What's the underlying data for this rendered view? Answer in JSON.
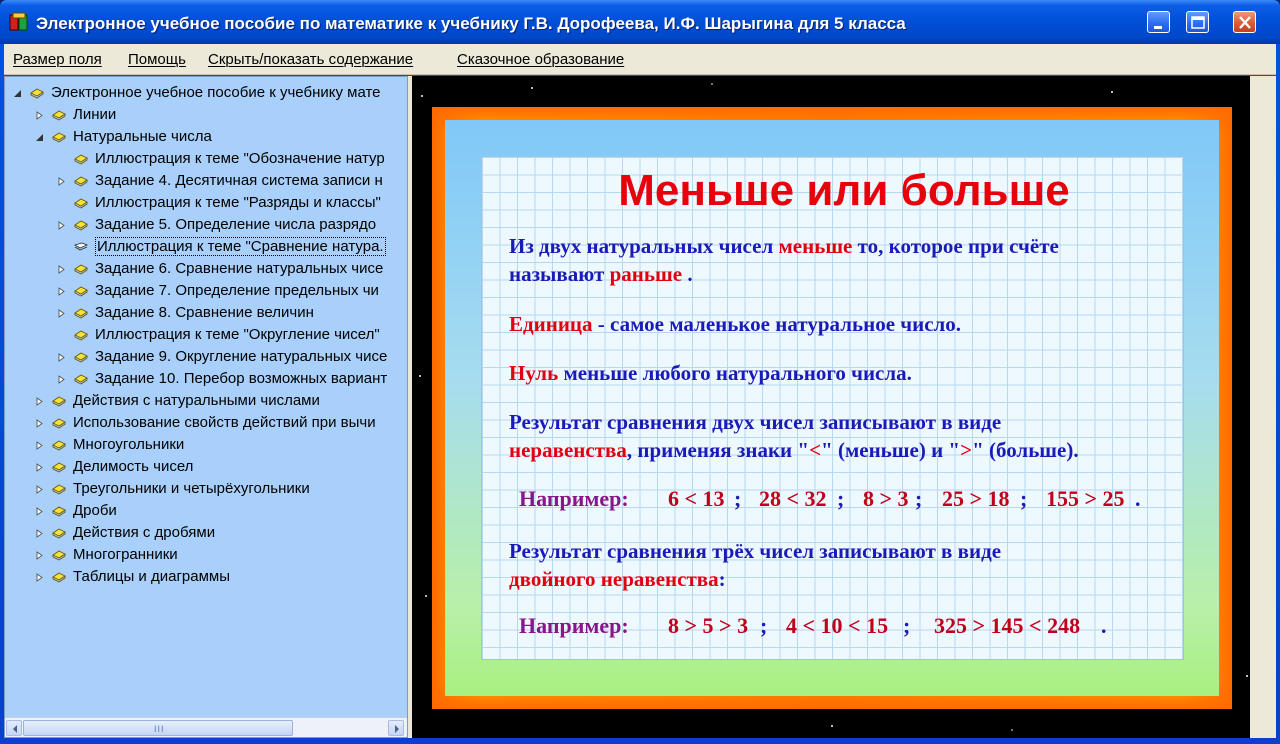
{
  "window": {
    "title": "Электронное учебное пособие по математике к учебнику Г.В. Дорофеева, И.Ф. Шарыгина для 5 класса"
  },
  "menu": [
    "Размер поля",
    "Помощь",
    "Скрыть/показать содержание",
    "Сказочное образование"
  ],
  "tree": {
    "root": "Электронное учебное пособие к учебнику мате",
    "items": [
      {
        "label": "Линии",
        "level": 1,
        "expander": "collapsed"
      },
      {
        "label": "Натуральные числа",
        "level": 1,
        "expander": "expanded"
      },
      {
        "label": "Иллюстрация к теме \"Обозначение натур",
        "level": 2,
        "expander": "none"
      },
      {
        "label": "Задание 4. Десятичная система записи н",
        "level": 2,
        "expander": "collapsed"
      },
      {
        "label": "Иллюстрация к теме \"Разряды и классы\"",
        "level": 2,
        "expander": "none"
      },
      {
        "label": "Задание 5. Определение числа разрядо",
        "level": 2,
        "expander": "collapsed"
      },
      {
        "label": "Иллюстрация к теме \"Сравнение натура.",
        "level": 2,
        "expander": "none",
        "selected": true
      },
      {
        "label": "Задание 6. Сравнение натуральных чисе",
        "level": 2,
        "expander": "collapsed"
      },
      {
        "label": "Задание 7. Определение предельных чи",
        "level": 2,
        "expander": "collapsed"
      },
      {
        "label": "Задание 8. Сравнение величин",
        "level": 2,
        "expander": "collapsed"
      },
      {
        "label": "Иллюстрация к теме \"Округление чисел\"",
        "level": 2,
        "expander": "none"
      },
      {
        "label": "Задание 9. Округление натуральных чисе",
        "level": 2,
        "expander": "collapsed"
      },
      {
        "label": "Задание 10. Перебор возможных вариант",
        "level": 2,
        "expander": "collapsed"
      },
      {
        "label": "Действия с натуральными числами",
        "level": 1,
        "expander": "collapsed"
      },
      {
        "label": "Использование свойств действий при вычи",
        "level": 1,
        "expander": "collapsed"
      },
      {
        "label": "Многоугольники",
        "level": 1,
        "expander": "collapsed"
      },
      {
        "label": "Делимость чисел",
        "level": 1,
        "expander": "collapsed"
      },
      {
        "label": "Треугольники и четырёхугольники",
        "level": 1,
        "expander": "collapsed"
      },
      {
        "label": "Дроби",
        "level": 1,
        "expander": "collapsed"
      },
      {
        "label": "Действия с дробями",
        "level": 1,
        "expander": "collapsed"
      },
      {
        "label": "Многогранники",
        "level": 1,
        "expander": "collapsed"
      },
      {
        "label": "Таблицы и диаграммы",
        "level": 1,
        "expander": "collapsed"
      }
    ],
    "scroll_grip": "III"
  },
  "slide": {
    "title": "Меньше или больше",
    "p1": {
      "a": "Из двух натуральных чисел ",
      "b": "меньше",
      "c": " то, которое при счёте",
      "d": "называют ",
      "e": "раньше",
      "f": " ."
    },
    "p2": {
      "a": "Единица",
      "b": " - самое маленькое натуральное число."
    },
    "p3": {
      "a": "Нуль",
      "b": " меньше любого натурального числа."
    },
    "p4": {
      "a": "Результат сравнения двух чисел записывают в виде",
      "b": "неравенства",
      "c": ", применяя знаки \"",
      "d": "<",
      "e": "\" (меньше) и \"",
      "f": ">",
      "g": "\" (больше)."
    },
    "ex1": {
      "label": "Например:",
      "items": [
        "6 < 13",
        "28 < 32",
        "8 > 3",
        "25 > 18",
        "155 > 25"
      ]
    },
    "p5": {
      "a": "Результат сравнения трёх чисел записывают в виде",
      "b": "двойного неравенства",
      "c": ":"
    },
    "ex2": {
      "label": "Например:",
      "items": [
        "8 > 5 > 3",
        "4 < 10 < 15",
        "325 > 145 < 248"
      ]
    }
  }
}
